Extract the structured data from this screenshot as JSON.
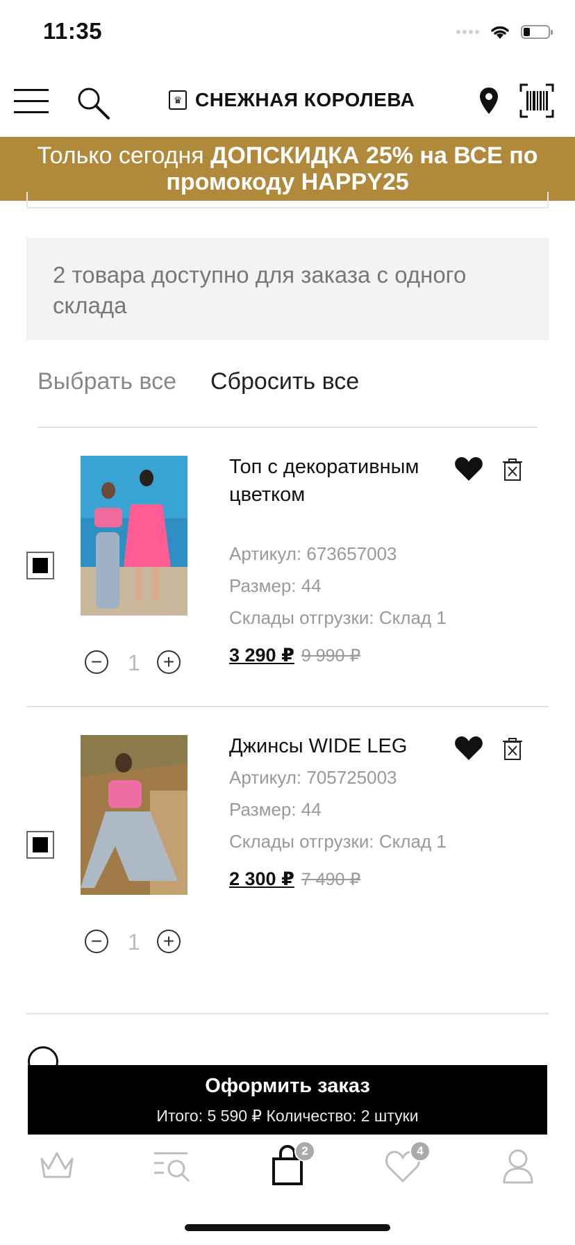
{
  "status_bar": {
    "time": "11:35"
  },
  "header": {
    "logo_text": "СНЕЖНАЯ КОРОЛЕВА",
    "menu_icon": "hamburger-menu-icon",
    "search_icon": "search-icon",
    "location_icon": "map-pin-icon",
    "barcode_icon": "barcode-icon"
  },
  "promo": {
    "text_normal": "Только сегодня ",
    "text_bold": "ДОПСКИДКА 25% на ВСЕ по промокоду HAPPY25",
    "background": "#b08a3a"
  },
  "cart": {
    "info": "2 товара доступно для заказа с одного склада",
    "select_all": "Выбрать все",
    "reset_all": "Сбросить все",
    "items": [
      {
        "title": "Топ с декоративным цветком",
        "article": "Артикул: 673657003",
        "size": "Размер: 44",
        "warehouse": "Склады отгрузки: Склад 1",
        "price": "3 290 ₽",
        "old_price": "9 990 ₽",
        "quantity": "1",
        "checked": true
      },
      {
        "title": "Джинсы WIDE LEG",
        "article": "Артикул: 705725003",
        "size": "Размер: 44",
        "warehouse": "Склады отгрузки: Склад 1",
        "price": "2 300 ₽",
        "old_price": "7 490 ₽",
        "quantity": "1",
        "checked": true
      }
    ]
  },
  "checkout": {
    "label": "Оформить заказ",
    "summary": "Итого: 5 590 ₽  Количество: 2 штуки"
  },
  "bottom_nav": {
    "cart_badge": "2",
    "favorites_badge": "4"
  }
}
